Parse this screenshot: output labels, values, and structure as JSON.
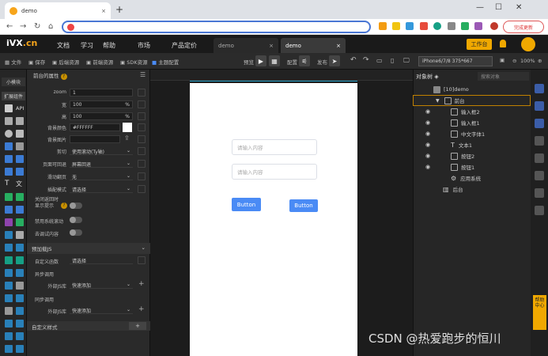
{
  "browser": {
    "tab_title": "demo",
    "new_tab": "+",
    "update_label": "完成更新",
    "win_min": "—",
    "win_max": "☐",
    "win_close": "✕"
  },
  "app": {
    "logo_main": "VX",
    "logo_suffix": ".cn",
    "nav": [
      "文档",
      "学习",
      "帮助",
      "市场",
      "产品定价"
    ],
    "doc_tabs": [
      "demo",
      "demo"
    ],
    "workbench": "工作台"
  },
  "toolbar": {
    "file": "文件",
    "save": "保存",
    "backend": "后端资源",
    "frontend": "前端资源",
    "sdk": "SDK资源",
    "theme": "主题配置",
    "preview": "预览",
    "config": "配置",
    "publish": "发布",
    "device": "iPhone6/7/8 375*667",
    "zoom": "100%"
  },
  "left_tabs": [
    "小模块",
    "扩展组件"
  ],
  "api_label": "API",
  "props": {
    "header": "前台的属性",
    "zoom_label": "zoom",
    "zoom_value": "1",
    "width_label": "宽",
    "width_value": "100",
    "width_unit": "%",
    "height_label": "高",
    "height_value": "100",
    "height_unit": "%",
    "bgcolor_label": "背景颜色",
    "bgcolor_value": "#FFFFFF",
    "bgimage_label": "背景图片",
    "clip_label": "剪切",
    "clip_value": "使用滚动(Ty轴)",
    "page_back_label": "页面可回退",
    "page_back_value": "屏幕回退",
    "scroll_label": "滑动翻页",
    "scroll_value": "无",
    "anim_label": "插配模式",
    "anim_value": "请选择",
    "toggle1_label_a": "关闭返回时",
    "toggle1_label_b": "显示提示",
    "toggle2_label": "禁用系统滚动",
    "toggle3_label": "去调试内容",
    "sec_preload": "预加载JS",
    "custom_func_label": "自定义函数",
    "custom_func_value": "请选择",
    "async_label": "异步调用",
    "ext_js_label": "外部JS库",
    "ext_js_value": "快速添加",
    "sync_label": "同步调用",
    "ext_js2_label": "外部JS库",
    "ext_js2_value": "快速添加",
    "sec_style": "自定义样式",
    "add": "+"
  },
  "canvas": {
    "input1_placeholder": "请输入内容",
    "input2_placeholder": "请输入内容",
    "button1": "Button",
    "button2": "Button"
  },
  "tree": {
    "header": "对象树",
    "search_placeholder": "搜索对象",
    "nodes": [
      "[10]demo",
      "前台",
      "输入框2",
      "输入框1",
      "中文字体1",
      "文本1",
      "按钮2",
      "按钮1",
      "应用系统",
      "后台"
    ]
  },
  "rail": {
    "help": "帮助中心"
  },
  "watermark": "CSDN @热爱跑步的恒川",
  "colors": {
    "accent": "#f0a800",
    "blue": "#4a8bf5",
    "guide": "#27a0c7"
  }
}
